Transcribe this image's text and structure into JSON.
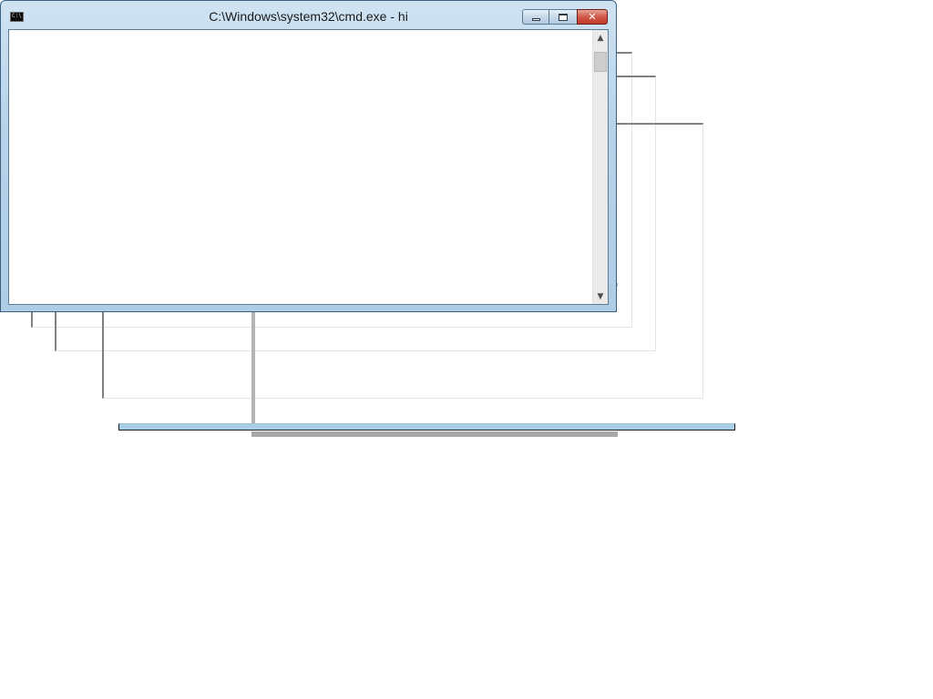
{
  "window": {
    "title": "C:\\Windows\\system32\\cmd.exe - hi",
    "icon": "console-icon",
    "icon_text": "C:\\",
    "buttons": {
      "minimize": "minimize-icon",
      "maximize": "maximize-icon",
      "close": "close-icon",
      "close_glyph": "✕"
    }
  },
  "console": {
    "text": ""
  },
  "scrollbar": {
    "up_arrow": "▲",
    "down_arrow": "▼"
  },
  "colors": {
    "frame": "#b7d3ea",
    "close": "#c2392b",
    "ghost_border": "#808080"
  }
}
